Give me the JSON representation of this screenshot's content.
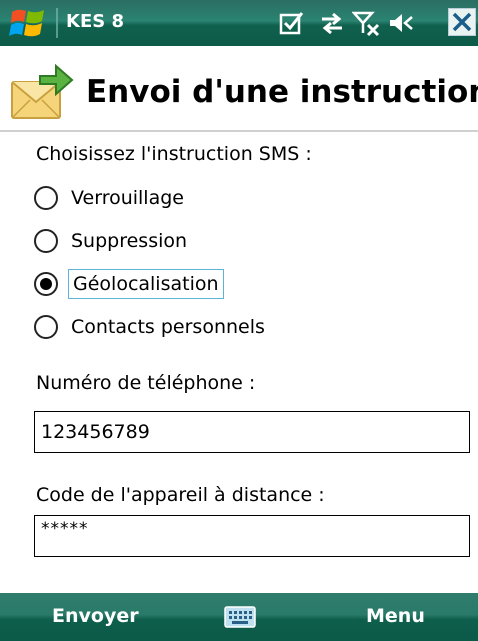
{
  "statusbar": {
    "app_title": "KES 8",
    "icons": [
      "windows-start-icon",
      "checkbox-icon",
      "connectivity-icon",
      "signal-off-icon",
      "volume-mute-icon",
      "close-icon"
    ]
  },
  "header": {
    "icon": "envelope-arrow-icon",
    "title": "Envoi d'une instruction"
  },
  "form": {
    "choose_label": "Choisissez l'instruction SMS :",
    "options": [
      {
        "label": "Verrouillage",
        "checked": false
      },
      {
        "label": "Suppression",
        "checked": false
      },
      {
        "label": "Géolocalisation",
        "checked": true
      },
      {
        "label": "Contacts personnels",
        "checked": false
      }
    ],
    "phone_label": "Numéro de téléphone :",
    "phone_value": "123456789",
    "code_label": "Code de l'appareil à distance :",
    "code_value": "*****"
  },
  "softkeys": {
    "left": "Envoyer",
    "center_icon": "keyboard-icon",
    "right": "Menu"
  },
  "colors": {
    "bar_green": "#1b6d5b",
    "focus_border": "#5eb4d6"
  }
}
